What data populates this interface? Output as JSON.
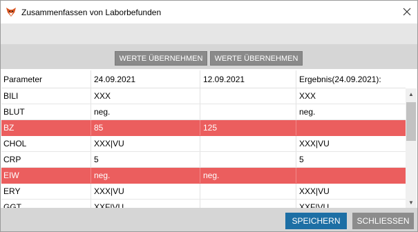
{
  "window": {
    "title": "Zusammenfassen von Laborbefunden",
    "icon": "fox-app-icon",
    "close_icon": "close-icon"
  },
  "toolbar": {
    "button1_label": "WERTE ÜBERNEHMEN",
    "button2_label": "WERTE ÜBERNEHMEN"
  },
  "table": {
    "headers": [
      "Parameter",
      "24.09.2021",
      "12.09.2021",
      "Ergebnis(24.09.2021):"
    ],
    "rows": [
      {
        "cells": [
          "BILI",
          "XXX",
          "",
          "XXX"
        ],
        "highlighted": false
      },
      {
        "cells": [
          "BLUT",
          "neg.",
          "",
          "neg."
        ],
        "highlighted": false
      },
      {
        "cells": [
          "BZ",
          "85",
          "125",
          ""
        ],
        "highlighted": true
      },
      {
        "cells": [
          "CHOL",
          "XXX|VU",
          "",
          "XXX|VU"
        ],
        "highlighted": false
      },
      {
        "cells": [
          "CRP",
          "5",
          "",
          "5"
        ],
        "highlighted": false
      },
      {
        "cells": [
          "EIW",
          "neg.",
          "neg.",
          ""
        ],
        "highlighted": true
      },
      {
        "cells": [
          "ERY",
          "XXX|VU",
          "",
          "XXX|VU"
        ],
        "highlighted": false
      },
      {
        "cells": [
          "GGT",
          "XXF|VU",
          "",
          "XXF|VU"
        ],
        "highlighted": false
      }
    ],
    "highlight_color": "#eb5e5e"
  },
  "footer": {
    "save_label": "SPEICHERN",
    "close_label": "SCHLIESSEN",
    "save_color": "#1d6fa5"
  }
}
